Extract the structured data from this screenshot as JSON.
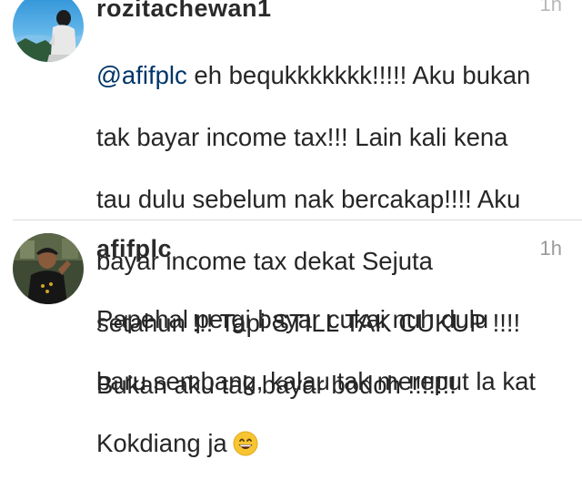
{
  "comments": [
    {
      "username": "rozitachewan1",
      "time": "1h",
      "mention": "@afifplc",
      "lines": [
        " eh bequkkkkkkk!!!!! Aku bukan",
        "tak bayar income tax!!! Lain kali kena",
        "tau dulu sebelum nak bercakap!!!! Aku",
        "bayar income tax dekat Sejuta",
        "setahun !!! Tapi STILL TAK CUKUP !!!!",
        "Bukan aku tak bayar bodoh !!!!!!!"
      ]
    },
    {
      "username": "afifplc",
      "time": "1h",
      "lines": [
        "Papehal pergi bayar cukai nuh dulu",
        "baru sembang, kalau tak mereput la kat",
        "Kokdiang ja"
      ],
      "emoji": "grinning-face-emoji"
    }
  ],
  "colors": {
    "text": "#262626",
    "mention": "#003569",
    "timestamp": "#9a9a9a",
    "divider": "#dbdbdb"
  }
}
